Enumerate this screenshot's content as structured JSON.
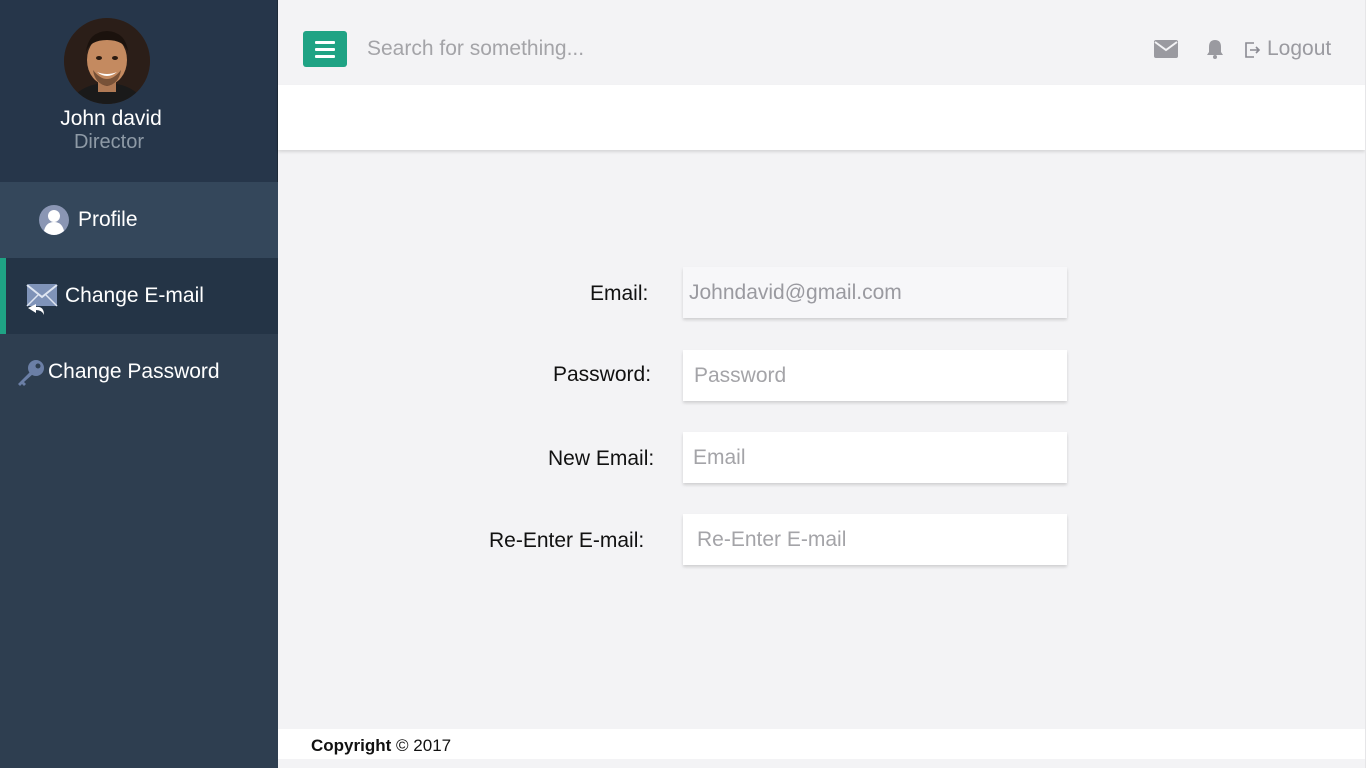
{
  "user": {
    "name": "John david",
    "role": "Director"
  },
  "sidebar": {
    "items": [
      {
        "label": "Profile",
        "icon": "user-icon",
        "active": false
      },
      {
        "label": "Change E-mail",
        "icon": "mail-reply-icon",
        "active": true
      },
      {
        "label": "Change Password",
        "icon": "key-icon",
        "active": false
      }
    ]
  },
  "header": {
    "search_placeholder": "Search for something...",
    "logout_label": "Logout",
    "icons": [
      "menu-icon",
      "envelope-icon",
      "bell-icon",
      "logout-icon"
    ]
  },
  "form": {
    "email_label": "Email:",
    "email_value": "Johndavid@gmail.com",
    "password_label": "Password:",
    "password_placeholder": "Password",
    "new_email_label": "New Email:",
    "new_email_placeholder": "Email",
    "reenter_label": "Re-Enter E-mail:",
    "reenter_placeholder": "Re-Enter E-mail"
  },
  "footer": {
    "copyright_label": "Copyright",
    "copyright_symbol": "©",
    "year": "2017"
  },
  "colors": {
    "accent": "#1fa384",
    "sidebar_bg": "#2e3e50",
    "sidebar_dark": "#243446",
    "content_bg": "#f3f3f5"
  }
}
